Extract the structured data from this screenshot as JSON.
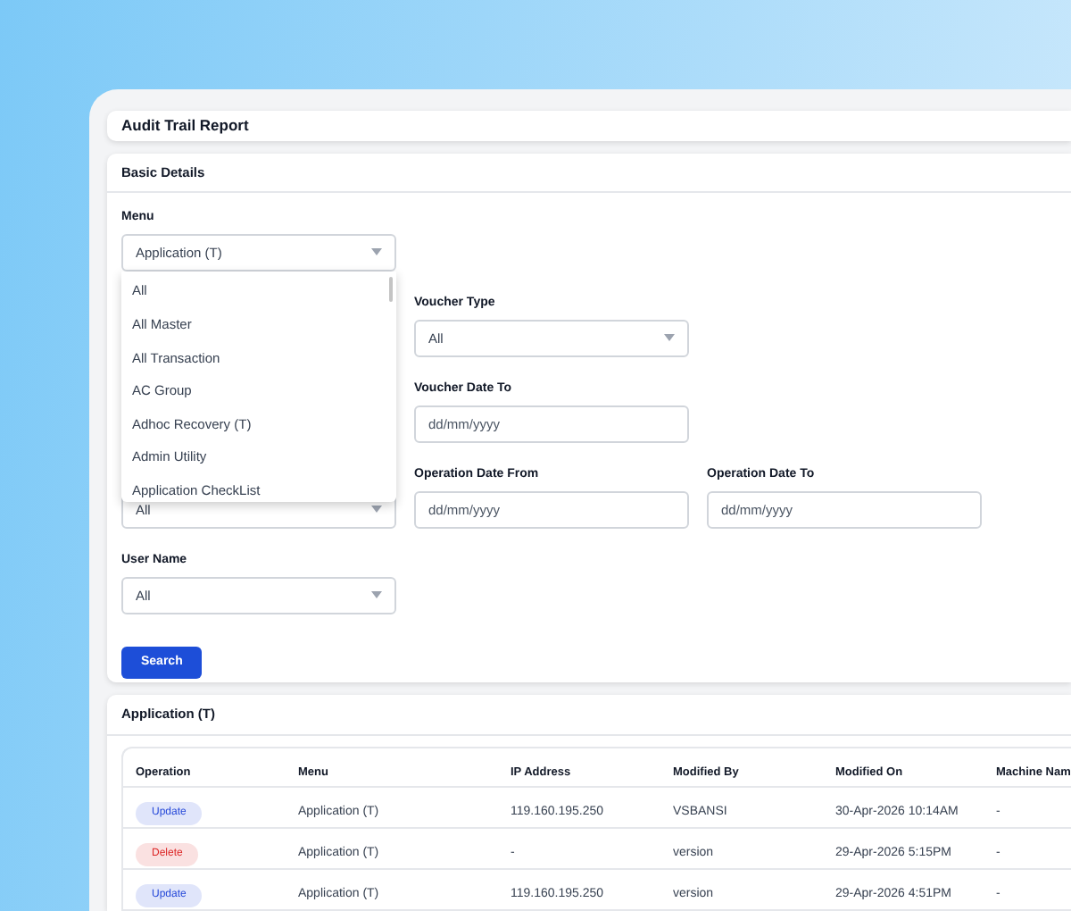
{
  "title": "Audit Trail Report",
  "basic_details": {
    "heading": "Basic Details",
    "rows": [
      [
        {
          "kind": "select",
          "label": "Menu",
          "value": "Application (T)"
        }
      ],
      [
        {
          "kind": "covered"
        },
        {
          "kind": "select",
          "label": "Voucher Type",
          "value": "All"
        }
      ],
      [
        {
          "kind": "covered"
        },
        {
          "kind": "date",
          "label": "Voucher Date To",
          "placeholder": "dd/mm/yyyy"
        }
      ],
      [
        {
          "kind": "select",
          "value": "All"
        },
        {
          "kind": "date",
          "label": "Operation Date From",
          "placeholder": "dd/mm/yyyy"
        },
        {
          "kind": "date",
          "label": "Operation Date To",
          "placeholder": "dd/mm/yyyy"
        }
      ],
      [
        {
          "kind": "select",
          "label": "User Name",
          "value": "All"
        }
      ]
    ],
    "menu_dropdown": [
      {
        "label": "All",
        "selected": false
      },
      {
        "label": "All Master",
        "selected": false
      },
      {
        "label": "All Transaction",
        "selected": false
      },
      {
        "label": "AC Group",
        "selected": false
      },
      {
        "label": "Adhoc Recovery (T)",
        "selected": false
      },
      {
        "label": "Admin Utility",
        "selected": false
      },
      {
        "label": "Application CheckList",
        "selected": false
      }
    ],
    "search_button": "Search"
  },
  "results": {
    "heading": "Application (T)",
    "columns": [
      "Operation",
      "Menu",
      "IP Address",
      "Modified By",
      "Modified On",
      "Machine Nam"
    ],
    "rows": [
      {
        "color": "#2447d8",
        "cells": [
          "Update",
          "Application (T)",
          "119.160.195.250",
          "VSBANSI",
          "30-Apr-2026 10:14AM",
          "-"
        ]
      },
      {
        "color": "#dc2626",
        "cells": [
          "Delete",
          "Application (T)",
          "-",
          "version",
          "29-Apr-2026 5:15PM",
          "-"
        ]
      },
      {
        "color": "#2447d8",
        "cells": [
          "Update",
          "Application (T)",
          "119.160.195.250",
          "version",
          "29-Apr-2026 4:51PM",
          "-"
        ]
      }
    ]
  }
}
